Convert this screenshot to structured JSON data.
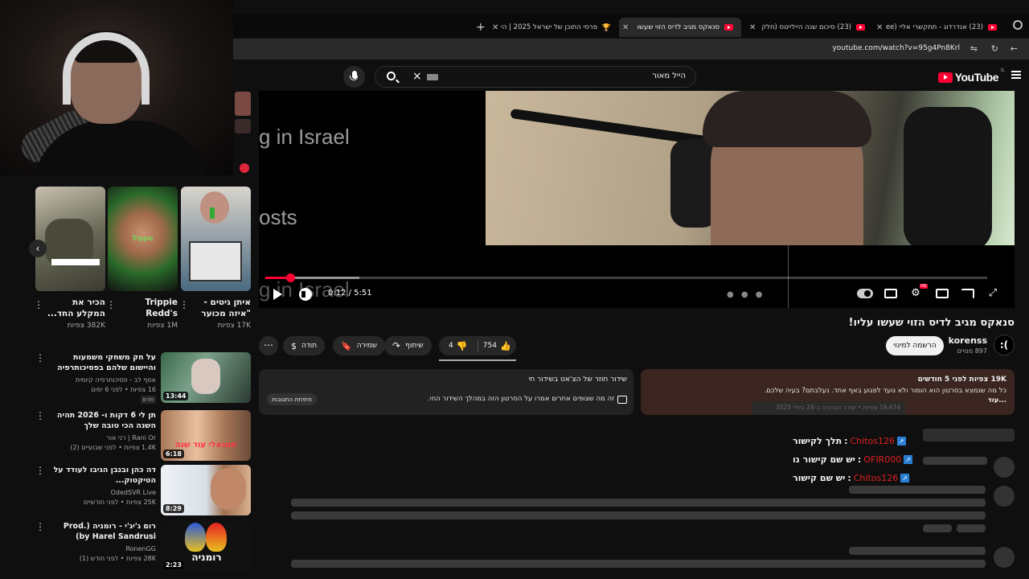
{
  "browser": {
    "tabs": [
      {
        "title": "פרסי התוכן של ישראל 2025 | הי",
        "active": false,
        "icon": "trophy-icon"
      },
      {
        "title": "סנאקס מגיב לדיס הזוי שעשו",
        "active": true,
        "icon": "youtube-icon"
      },
      {
        "title": "(23) סיכום שנה היילייטס (חלק",
        "active": false,
        "icon": "youtube-icon"
      },
      {
        "title": "(23) אנדרדוג - תתקשרי אליי (ee",
        "active": false,
        "icon": "youtube-icon"
      }
    ],
    "url": "youtube.com/watch?v=95g4Pn8Krl"
  },
  "header": {
    "logo": "YouTube",
    "region": "IL",
    "search_value": "הייל מאור"
  },
  "player": {
    "overlay_text_1": "g in Israel",
    "overlay_text_2": "osts",
    "overlay_text_3": "g in Israel",
    "time_display": "0:12 / 5:51",
    "progress_fraction": 0.034,
    "buffer_fraction": 0.13
  },
  "video": {
    "title": "סנאקס מגיב לדיס הזוי שעשו עליו!",
    "channel_name": "korenss",
    "channel_avatar": ":(",
    "channel_subs": "897 מנויים",
    "subscribe_label": "הרשמה למינוי",
    "likes": "754",
    "dislikes": "4",
    "share_label": "שיתוף",
    "save_label": "שמירה",
    "thanks_label": "תודה"
  },
  "description": {
    "stats": "19K צפיות  לפני 5 חודשים",
    "text": "כל מה שנמצא בסרטון הוא הומור ולא נועד לפגוע באף אחד. נעלבתם? בעיה שלכם.",
    "more": "...עוד",
    "tooltip": "19,474 צפיות • שודר הבכורה ב-24 ביולי 2025"
  },
  "live_card": {
    "title": "שידור חוזר של הצ'אט בשידור חי",
    "note": "זה מה שצופים אחרים אמרו על הסרטון הזה במהלך השידור החי.",
    "button": "פתיחת התגובות"
  },
  "chat": [
    {
      "message": "תלך לקישור",
      "user": "Chitos126"
    },
    {
      "message": "יש שם קישור נו",
      "user": "OFIR000"
    },
    {
      "message": "יש שם קישור",
      "user": "Chitos126"
    }
  ],
  "shorts": [
    {
      "title": "איתן גיטים - \"איזה מכוער",
      "views": "17K צפיות"
    },
    {
      "title": "Trippie Redd's Wish...",
      "views": "1M צפיות"
    },
    {
      "title": "הכיר את המקלע החד...",
      "views": "382K צפיות"
    }
  ],
  "recommendations": [
    {
      "title": "על חק משחקי משמעות והיישום שלהם בפסיכותרפיה",
      "channel": "אסף לב - פסיכותרפיה קיומית",
      "meta": "16 צפיות • לפני 6 ימים",
      "badge": "חדש",
      "duration": "13:44"
    },
    {
      "title": "תן לי 6 דקות ו- 2026 תהיה השנה הכי טובה שלך",
      "channel": "Rani Or | רני אור",
      "meta": "1.4K צפיות • לפני שבועיים (2)",
      "badge": "",
      "duration": "6:18"
    },
    {
      "title": "דה כהן ובנבן הגיבו לעודד על הטיקטוק...",
      "channel": "OdedSVR Live",
      "meta": "25K צפיות • לפני חודשיים",
      "badge": "",
      "duration": "8:29"
    },
    {
      "title": "רום ג'יג'י - רומניה (Prod. by Harel Sandrusi)",
      "channel": "RonenGG",
      "meta": "28K צפיות • לפני חודש (1)",
      "badge": "",
      "duration": "2:23"
    }
  ]
}
